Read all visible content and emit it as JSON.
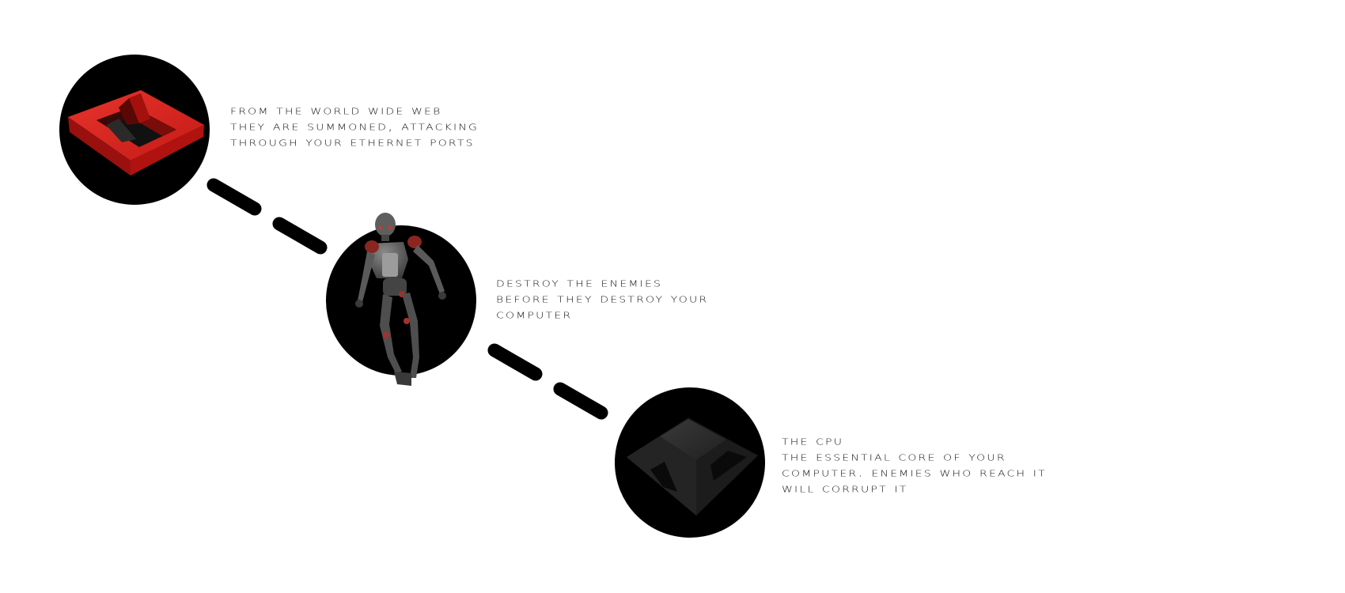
{
  "stages": [
    {
      "id": "spawn",
      "icon": "spawn-portal-icon",
      "lines": [
        "From the World Wide Web",
        "they are summoned, attacking",
        "through your ethernet ports"
      ]
    },
    {
      "id": "enemies",
      "icon": "robot-enemy-icon",
      "lines": [
        "Destroy the enemies",
        "before they destroy your",
        "computer"
      ]
    },
    {
      "id": "cpu",
      "icon": "cpu-core-icon",
      "lines": [
        "The CPU",
        "The essential core of your",
        "computer. Enemies who reach it",
        "will corrupt it"
      ]
    }
  ],
  "colors": {
    "background": "#ffffff",
    "circle": "#000000",
    "dash": "#000000",
    "text": "#111111",
    "portal_red": "#d8201c",
    "robot_gray": "#4a4a4a",
    "robot_accent": "#b83228",
    "cpu_gray": "#2a2a2a"
  }
}
